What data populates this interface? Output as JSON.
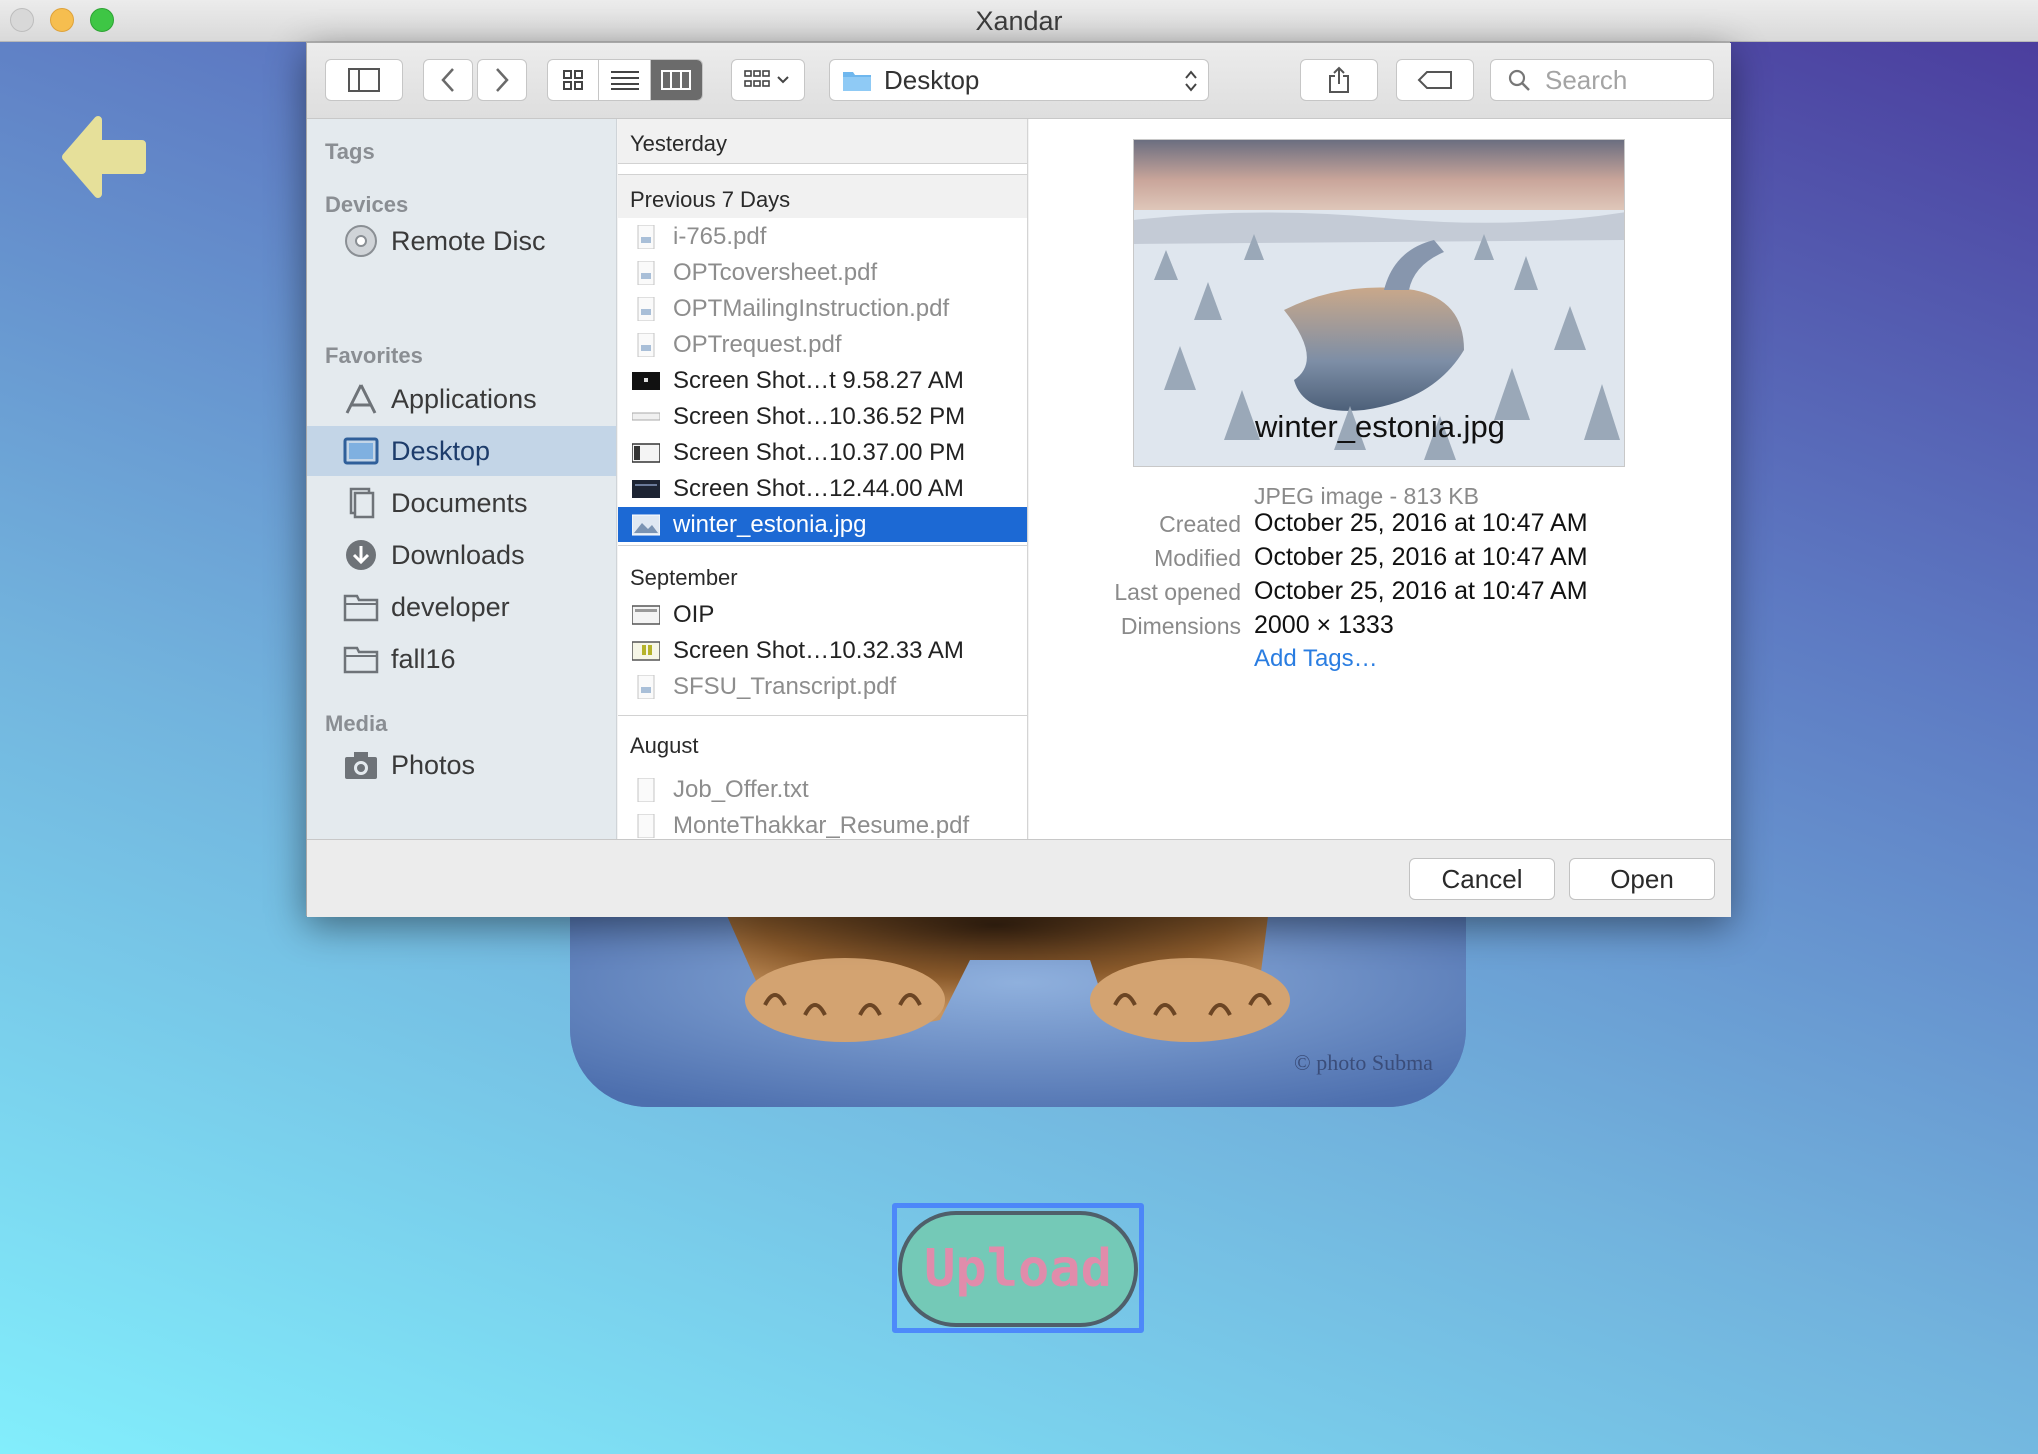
{
  "window": {
    "title": "Xandar"
  },
  "toolbar": {
    "location": "Desktop",
    "search_placeholder": "Search"
  },
  "sidebar": {
    "tags_header": "Tags",
    "devices_header": "Devices",
    "devices": [
      {
        "label": "Remote Disc",
        "icon": "disc-icon"
      }
    ],
    "favorites_header": "Favorites",
    "favorites": [
      {
        "label": "Applications",
        "icon": "applications-icon"
      },
      {
        "label": "Desktop",
        "icon": "desktop-icon",
        "selected": true
      },
      {
        "label": "Documents",
        "icon": "documents-icon"
      },
      {
        "label": "Downloads",
        "icon": "downloads-icon"
      },
      {
        "label": "developer",
        "icon": "folder-icon"
      },
      {
        "label": "fall16",
        "icon": "folder-icon"
      }
    ],
    "media_header": "Media",
    "media": [
      {
        "label": "Photos",
        "icon": "camera-icon"
      }
    ]
  },
  "files": {
    "groups": [
      {
        "header": "Yesterday",
        "items": []
      },
      {
        "header": "Previous 7 Days",
        "items": [
          {
            "name": "i-765.pdf",
            "dim": true
          },
          {
            "name": "OPTcoversheet.pdf",
            "dim": true
          },
          {
            "name": "OPTMailingInstruction.pdf",
            "dim": true
          },
          {
            "name": "OPTrequest.pdf",
            "dim": true
          },
          {
            "name": "Screen Shot…t 9.58.27 AM"
          },
          {
            "name": "Screen Shot…10.36.52 PM"
          },
          {
            "name": "Screen Shot…10.37.00 PM"
          },
          {
            "name": "Screen Shot…12.44.00 AM"
          },
          {
            "name": "winter_estonia.jpg",
            "selected": true
          }
        ]
      },
      {
        "header": "September",
        "items": [
          {
            "name": "OIP"
          },
          {
            "name": "Screen Shot…10.32.33 AM"
          },
          {
            "name": "SFSU_Transcript.pdf",
            "dim": true
          }
        ]
      },
      {
        "header": "August",
        "items": [
          {
            "name": "Job_Offer.txt",
            "dim": true
          },
          {
            "name": "MonteThakkar_Resume.pdf",
            "dim": true
          }
        ]
      }
    ]
  },
  "preview": {
    "filename": "winter_estonia.jpg",
    "kind": "JPEG image - 813 KB",
    "created_label": "Created",
    "created": "October 25, 2016 at 10:47 AM",
    "modified_label": "Modified",
    "modified": "October 25, 2016 at 10:47 AM",
    "opened_label": "Last opened",
    "opened": "October 25, 2016 at 10:47 AM",
    "dimensions_label": "Dimensions",
    "dimensions": "2000 × 1333",
    "add_tags": "Add Tags…"
  },
  "buttons": {
    "cancel": "Cancel",
    "open": "Open"
  },
  "app": {
    "upload_label": "Upload",
    "watermark": "© photo Subma"
  },
  "colors": {
    "accent": "#1c69d4",
    "link": "#2a7de1",
    "upload_bg": "#74c9b7",
    "upload_text": "#e08cab"
  }
}
